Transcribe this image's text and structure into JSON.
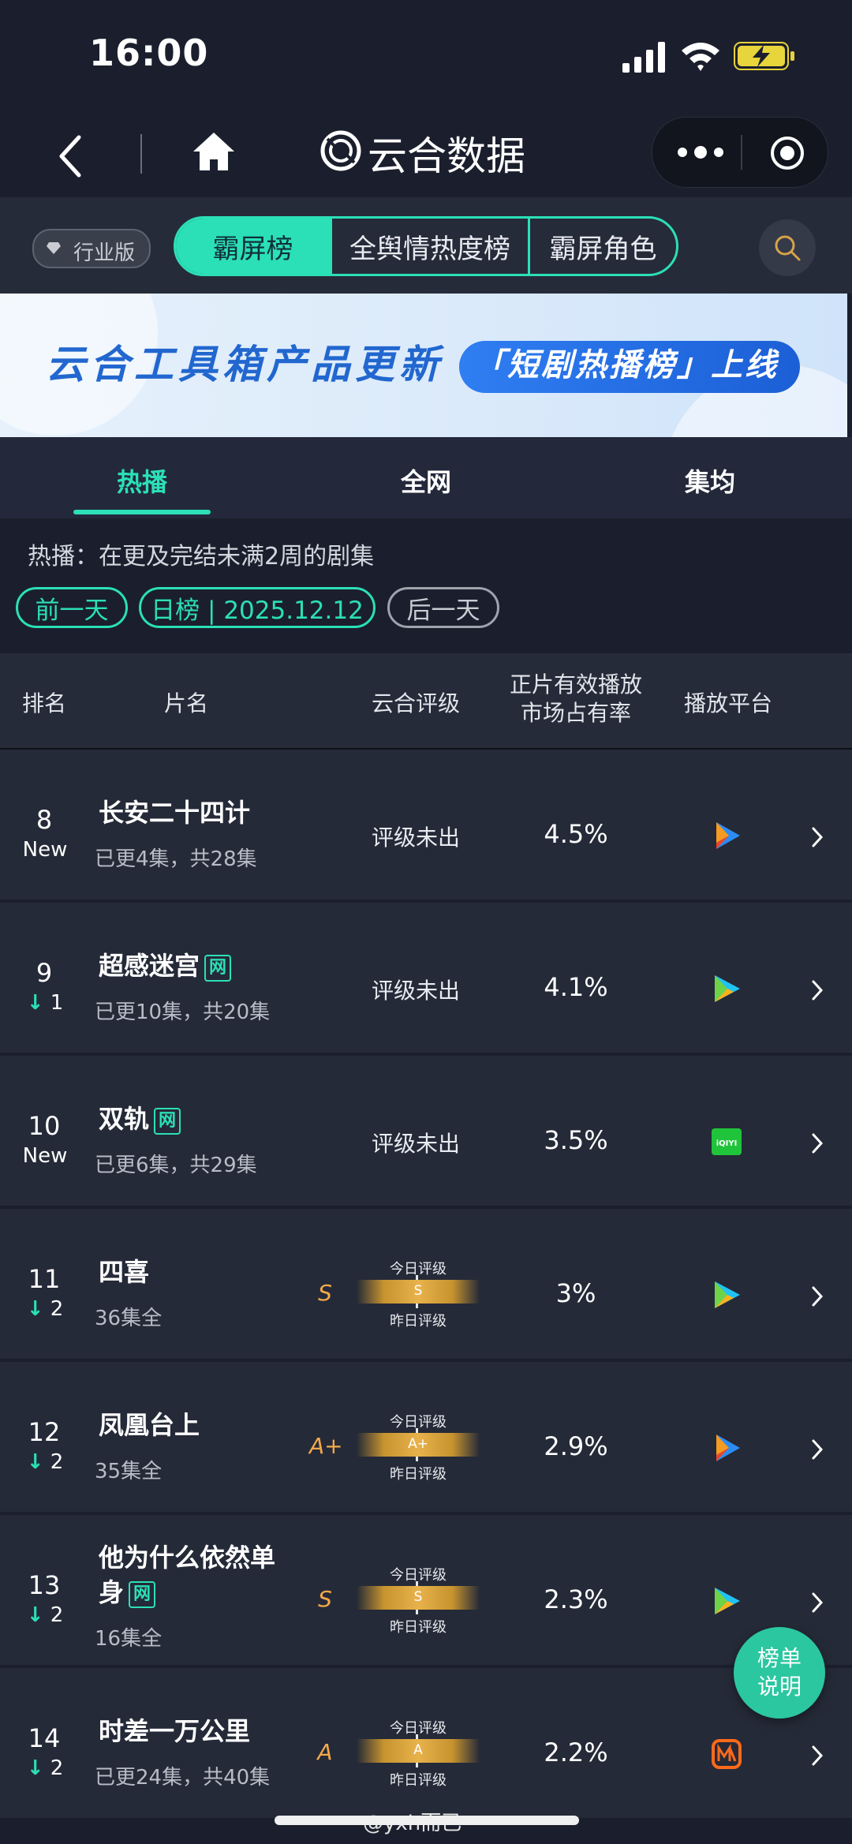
{
  "status": {
    "time": "16:00"
  },
  "nav": {
    "title": "云合数据"
  },
  "top_tabs": {
    "edition": "行业版",
    "tabs": [
      "霸屏榜",
      "全舆情热度榜",
      "霸屏角色"
    ]
  },
  "banner": {
    "title": "云合工具箱产品更新",
    "highlight": "「短剧热播榜」上线"
  },
  "sub_tabs": [
    "热播",
    "全网",
    "集均"
  ],
  "description": "热播：在更及完结未满2周的剧集",
  "date_nav": {
    "prev": "前一天",
    "current": "日榜 | 2025.12.12",
    "next": "后一天"
  },
  "table": {
    "headers": {
      "rank": "排名",
      "title": "片名",
      "rating": "云合评级",
      "share_line1": "正片有效播放",
      "share_line2": "市场占有率",
      "platform": "播放平台"
    },
    "rating_labels": {
      "today": "今日评级",
      "yesterday": "昨日评级"
    },
    "rows": [
      {
        "rank": "8",
        "change": "New",
        "title": "长安二十四计",
        "wang": "",
        "eps": "已更4集，共28集",
        "rating": "评级未出",
        "grade": "",
        "share": "4.5%",
        "platform": "tencent-video-icon"
      },
      {
        "rank": "9",
        "change": "1",
        "title": "超感迷宫",
        "wang": "网",
        "eps": "已更10集，共20集",
        "rating": "评级未出",
        "grade": "",
        "share": "4.1%",
        "platform": "youku-icon"
      },
      {
        "rank": "10",
        "change": "New",
        "title": "双轨",
        "wang": "网",
        "eps": "已更6集，共29集",
        "rating": "评级未出",
        "grade": "",
        "share": "3.5%",
        "platform": "iqiyi-icon"
      },
      {
        "rank": "11",
        "change": "2",
        "title": "四喜",
        "wang": "",
        "eps": "36集全",
        "rating": "",
        "grade": "S",
        "share": "3%",
        "platform": "youku-icon"
      },
      {
        "rank": "12",
        "change": "2",
        "title": "凤凰台上",
        "wang": "",
        "eps": "35集全",
        "rating": "",
        "grade": "A+",
        "share": "2.9%",
        "platform": "tencent-video-icon"
      },
      {
        "rank": "13",
        "change": "2",
        "title_line1": "他为什么依然单",
        "title_line2": "身",
        "wang": "网",
        "eps": "16集全",
        "rating": "",
        "grade": "S",
        "share": "2.3%",
        "platform": "youku-icon"
      },
      {
        "rank": "14",
        "change": "2",
        "title": "时差一万公里",
        "wang": "",
        "eps": "已更24集，共40集",
        "rating": "",
        "grade": "A",
        "share": "2.2%",
        "platform": "mgtv-icon"
      }
    ]
  },
  "iqiyi_logo_text": "iQIYI",
  "fab": {
    "line1": "榜单",
    "line2": "说明"
  },
  "credit": "@yxh而已"
}
